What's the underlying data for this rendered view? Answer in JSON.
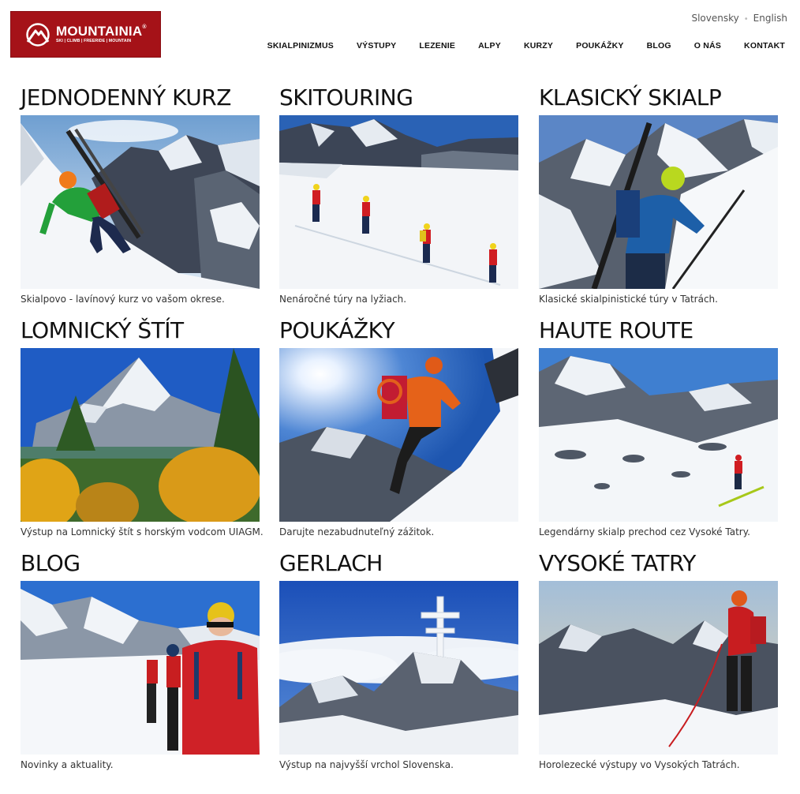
{
  "brand": {
    "name": "MOUNTAINIA",
    "tagline": "SKI | CLIMB | FREERIDE | MOUNTAIN",
    "color": "#a51218"
  },
  "languages": [
    "Slovensky",
    "English"
  ],
  "nav": [
    "SKIALPINIZMUS",
    "VÝSTUPY",
    "LEZENIE",
    "ALPY",
    "KURZY",
    "POUKÁŽKY",
    "BLOG",
    "O NÁS",
    "KONTAKT"
  ],
  "cards": [
    {
      "title": "JEDNODENNÝ KURZ",
      "description": "Skialpovo - lavínový kurz vo vašom okrese.",
      "image": "skier-green-jacket-skis-on-back"
    },
    {
      "title": "SKITOURING",
      "description": "Nenáročné túry na lyžiach.",
      "image": "group-ski-touring-snowfield"
    },
    {
      "title": "KLASICKÝ SKIALP",
      "description": "Klasické skialpinistické túry v Tatrách.",
      "image": "skier-blue-jacket-steep-slope"
    },
    {
      "title": "LOMNICKÝ ŠTÍT",
      "description": "Výstup na Lomnický štít s horským vodcom UIAGM.",
      "image": "lomnicky-peak-autumn-forest"
    },
    {
      "title": "POUKÁŽKY",
      "description": "Darujte nezabudnuteľný zážitok.",
      "image": "climber-orange-jacket-sun"
    },
    {
      "title": "HAUTE ROUTE",
      "description": "Legendárny skialp prechod cez Vysoké Tatry.",
      "image": "lone-skier-mountain-valley"
    },
    {
      "title": "BLOG",
      "description": "Novinky a aktuality.",
      "image": "skiers-red-jackets-yellow-hat"
    },
    {
      "title": "GERLACH",
      "description": "Výstup na najvyšší vrchol Slovenska.",
      "image": "summit-cross-frosted"
    },
    {
      "title": "VYSOKÉ TATRY",
      "description": "Horolezecké výstupy vo Vysokých Tatrách.",
      "image": "climber-red-jacket-rope"
    }
  ]
}
